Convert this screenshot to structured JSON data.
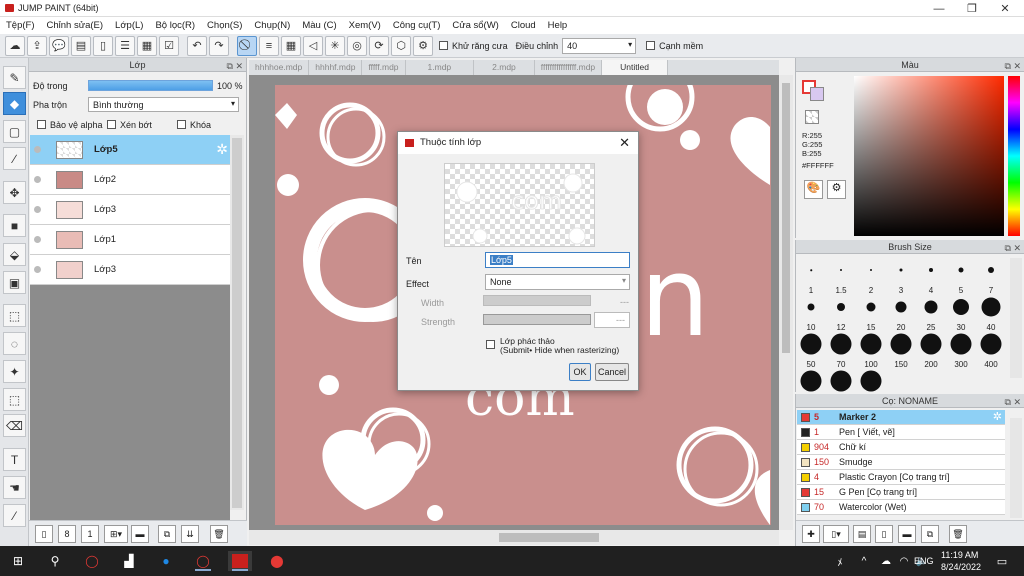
{
  "window": {
    "title": "JUMP PAINT (64bit)",
    "minimize": "—",
    "maximize": "❐",
    "close": "✕"
  },
  "menu": [
    "Tệp(F)",
    "Chỉnh sửa(E)",
    "Lớp(L)",
    "Bộ lọc(R)",
    "Chọn(S)",
    "Chụp(N)",
    "Màu (C)",
    "Xem(V)",
    "Công cụ(T)",
    "Cửa sổ(W)",
    "Cloud",
    "Help"
  ],
  "toolbar": {
    "antialias_label": "Khử răng cưa",
    "adjust_label": "Điều chỉnh",
    "adjust_value": "40",
    "margin_label": "Cạnh mềm"
  },
  "layer_panel": {
    "title": "Lớp",
    "opacity_label": "Độ trong",
    "opacity_value": "100 %",
    "blend_label": "Pha trộn",
    "blend_value": "Bình thường",
    "protect_alpha": "Bảo vệ alpha",
    "clip": "Xén bớt",
    "lock": "Khóa",
    "layers": [
      "Lớp5",
      "Lớp2",
      "Lớp3",
      "Lớp1",
      "Lớp3"
    ]
  },
  "doc_tabs": [
    "hhhhoe.mdp",
    "hhhhf.mdp",
    "fffff.mdp",
    "1.mdp",
    "2.mdp",
    "ffffffffffffffff.mdp",
    "Untitled"
  ],
  "dialog": {
    "title": "Thuộc tính lớp",
    "name_label": "Tên",
    "name_value": "Lớp5",
    "effect_label": "Effect",
    "effect_value": "None",
    "width_label": "Width",
    "width_value": "---",
    "strength_label": "Strength",
    "strength_value": "---",
    "draft_label": "Lớp phác thảo",
    "draft_note": "(Submit• Hide when rasterizing)",
    "ok": "OK",
    "cancel": "Cancel"
  },
  "color_panel": {
    "title": "Màu",
    "r": "R:255",
    "g": "G:255",
    "b": "B:255",
    "hex": "#FFFFFF"
  },
  "brush_panel": {
    "title": "Brush Size",
    "sizes": [
      "1",
      "1.5",
      "2",
      "3",
      "4",
      "5",
      "7",
      "10",
      "12",
      "15",
      "20",
      "25",
      "30",
      "40",
      "50",
      "70",
      "100",
      "150",
      "200",
      "300",
      "400",
      "",
      "",
      ""
    ]
  },
  "material_panel": {
    "title": "Cọ: NONAME",
    "items": [
      {
        "size": "5",
        "name": "Marker 2",
        "color": "#e53935"
      },
      {
        "size": "1",
        "name": "Pen [ Viết, vẽ]",
        "color": "#222222"
      },
      {
        "size": "904",
        "name": "Chữ kí",
        "color": "#f5d000"
      },
      {
        "size": "150",
        "name": "Smudge",
        "color": "#f2e3c0"
      },
      {
        "size": "4",
        "name": "Plastic Crayon [Cọ trang trí]",
        "color": "#f5d000"
      },
      {
        "size": "15",
        "name": "G Pen [Cọ trang trí]",
        "color": "#e53935"
      },
      {
        "size": "70",
        "name": "Watercolor (Wet)",
        "color": "#7fd0f0"
      }
    ]
  },
  "taskbar": {
    "time": "11:19 AM",
    "date": "8/24/2022",
    "lang": "ENG"
  }
}
